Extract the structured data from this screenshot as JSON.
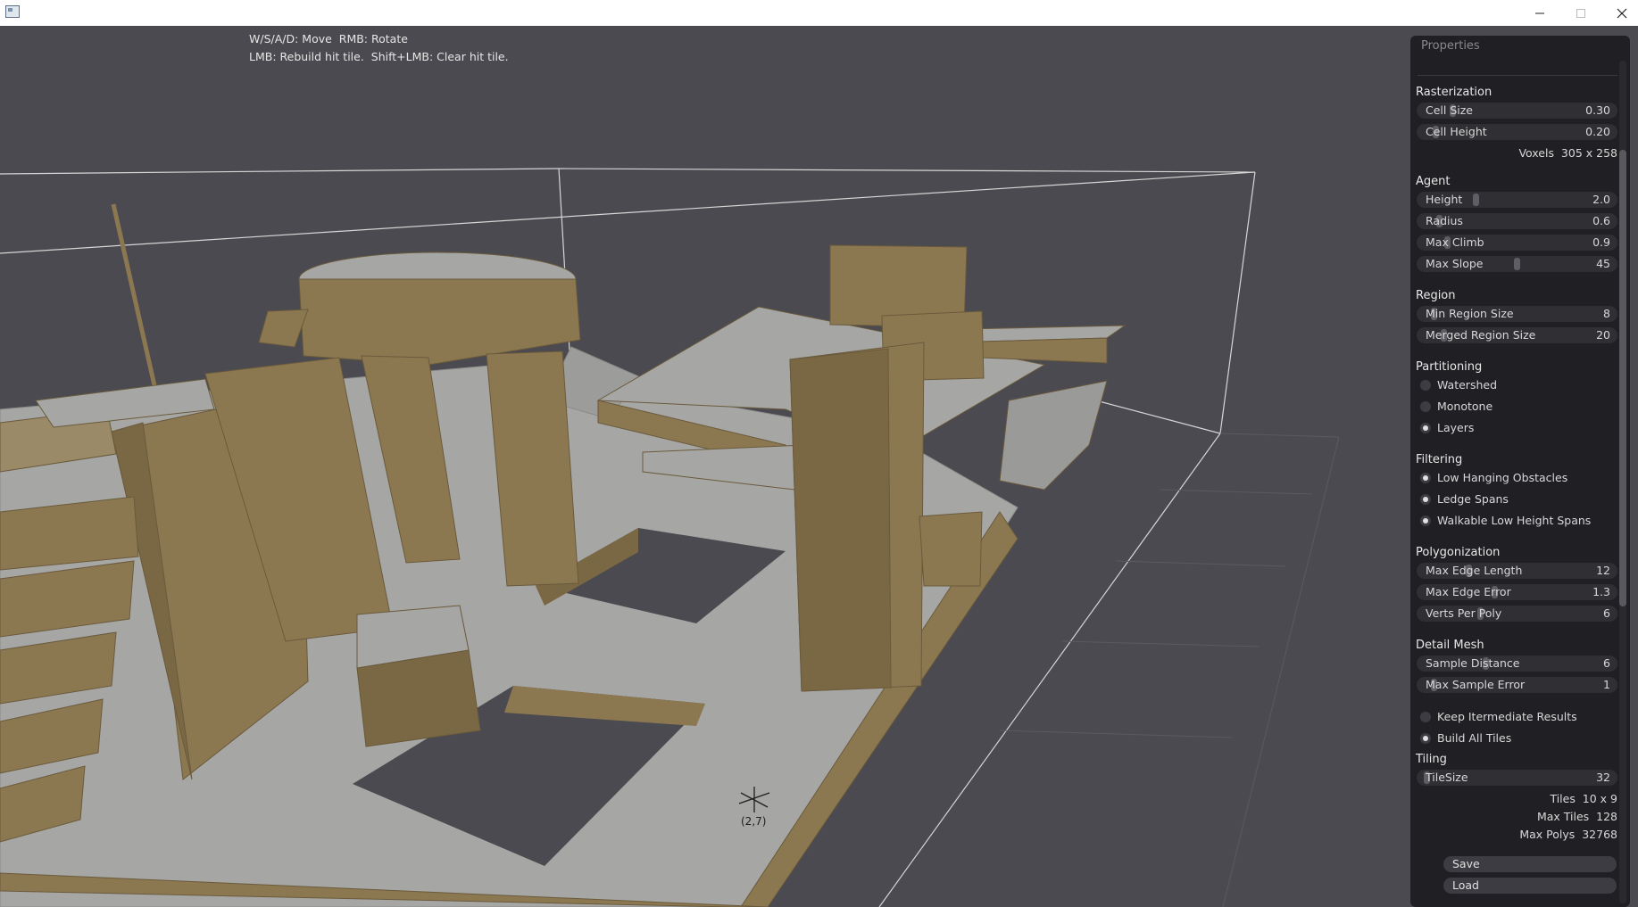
{
  "window": {
    "icon": "app-icon",
    "controls": [
      "minimize-icon",
      "maximize-icon",
      "close-icon"
    ]
  },
  "viewport": {
    "help_line1": "W/S/A/D: Move  RMB: Rotate",
    "help_line2": "LMB: Rebuild hit tile.  Shift+LMB: Clear hit tile.",
    "tile_marker": "(2,7)"
  },
  "colors": {
    "background": "#4a4a50",
    "geometry_tan": "#8c7850",
    "floor_gray": "#a6a6a4",
    "panel": "#202024"
  },
  "panel": {
    "title": "Properties",
    "rasterization": {
      "title": "Rasterization",
      "cell_size": {
        "label": "Cell Size",
        "value": "0.30",
        "level": 0.15
      },
      "cell_height": {
        "label": "Cell Height",
        "value": "0.20",
        "level": 0.06
      },
      "voxels": "Voxels  305 x 258"
    },
    "agent": {
      "title": "Agent",
      "height": {
        "label": "Height",
        "value": "2.0",
        "level": 0.28
      },
      "radius": {
        "label": "Radius",
        "value": "0.6",
        "level": 0.08
      },
      "max_climb": {
        "label": "Max Climb",
        "value": "0.9",
        "level": 0.12
      },
      "max_slope": {
        "label": "Max Slope",
        "value": "45",
        "level": 0.5
      }
    },
    "region": {
      "title": "Region",
      "min_region_size": {
        "label": "Min Region Size",
        "value": "8",
        "level": 0.05
      },
      "merged_region_size": {
        "label": "Merged Region Size",
        "value": "20",
        "level": 0.1
      }
    },
    "partitioning": {
      "title": "Partitioning",
      "options": [
        {
          "label": "Watershed",
          "checked": false
        },
        {
          "label": "Monotone",
          "checked": false
        },
        {
          "label": "Layers",
          "checked": true
        }
      ]
    },
    "filtering": {
      "title": "Filtering",
      "options": [
        {
          "label": "Low Hanging Obstacles",
          "checked": true
        },
        {
          "label": "Ledge Spans",
          "checked": true
        },
        {
          "label": "Walkable Low Height Spans",
          "checked": true
        }
      ]
    },
    "polygonization": {
      "title": "Polygonization",
      "max_edge_length": {
        "label": "Max Edge Length",
        "value": "12",
        "level": 0.24
      },
      "max_edge_error": {
        "label": "Max Edge Error",
        "value": "1.3",
        "level": 0.38
      },
      "verts_per_poly": {
        "label": "Verts Per Poly",
        "value": "6",
        "level": 0.3
      }
    },
    "detail_mesh": {
      "title": "Detail Mesh",
      "sample_distance": {
        "label": "Sample Distance",
        "value": "6",
        "level": 0.33
      },
      "max_sample_error": {
        "label": "Max Sample Error",
        "value": "1",
        "level": 0.05
      }
    },
    "options": [
      {
        "label": "Keep Itermediate Results",
        "checked": false
      },
      {
        "label": "Build All Tiles",
        "checked": true
      }
    ],
    "tiling": {
      "title": "Tiling",
      "tile_size": {
        "label": "TileSize",
        "value": "32",
        "level": 0.01
      },
      "tiles": "Tiles  10 x 9",
      "max_tiles": "Max Tiles  128",
      "max_polys": "Max Polys  32768"
    },
    "save_label": "Save",
    "load_label": "Load"
  }
}
